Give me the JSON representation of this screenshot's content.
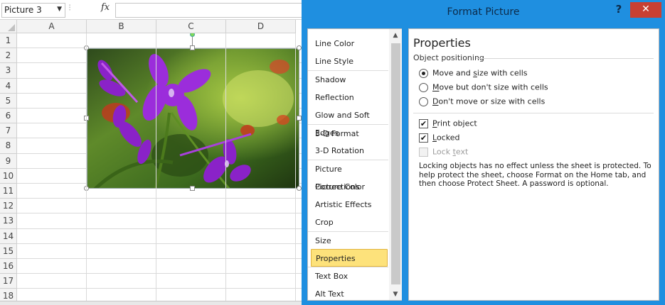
{
  "excel": {
    "name_box": "Picture 3",
    "fx_label": "fx",
    "columns": [
      "A",
      "B",
      "C",
      "D"
    ],
    "rows": [
      "1",
      "2",
      "3",
      "4",
      "5",
      "6",
      "7",
      "8",
      "9",
      "10",
      "11",
      "12",
      "13",
      "14",
      "15",
      "16",
      "17",
      "18"
    ]
  },
  "dialog": {
    "title": "Format Picture",
    "help": "?",
    "close": "✕",
    "nav": [
      "Line Color",
      "Line Style",
      "Shadow",
      "Reflection",
      "Glow and Soft Edges",
      "3-D Format",
      "3-D Rotation",
      "Picture Corrections",
      "Picture Color",
      "Artistic Effects",
      "Crop",
      "Size",
      "Properties",
      "Text Box",
      "Alt Text"
    ],
    "active_nav": "Properties",
    "content": {
      "title": "Properties",
      "group_label": "Object positioning",
      "radio_1": "Move and size with cells",
      "radio_2": "Move but don't size with cells",
      "radio_3": "Don't move or size with cells",
      "check_print": "Print object",
      "check_locked": "Locked",
      "check_lock_text": "Lock text",
      "info": "Locking objects has no effect unless the sheet is protected. To help protect the sheet, choose Format on the Home tab, and then choose Protect Sheet. A password is optional."
    }
  },
  "colors": {
    "title_bar": "#1f8fe0",
    "close_button": "#c84032",
    "active_nav": "#fde27b"
  }
}
